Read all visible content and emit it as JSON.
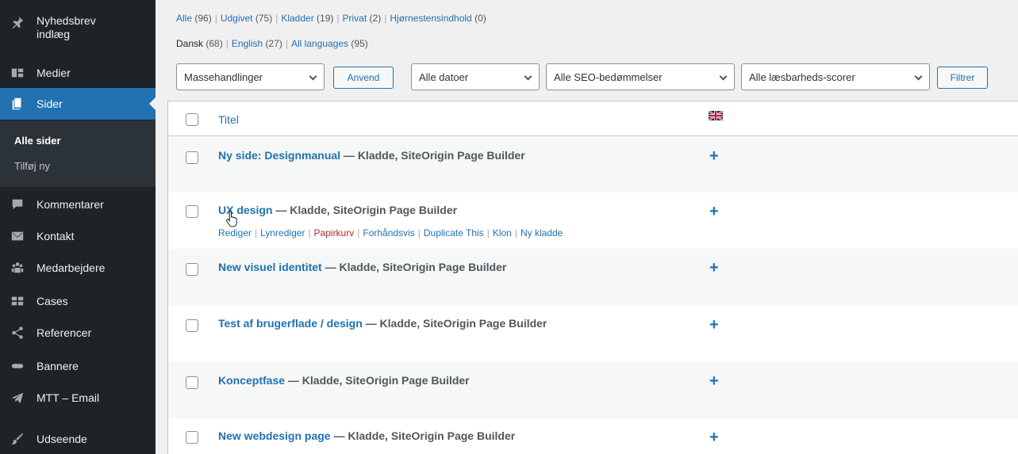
{
  "sidebar": {
    "items": [
      {
        "label": "Nyhedsbrev indlæg",
        "line1": "Nyhedsbrev",
        "line2": "indlæg",
        "icon": "pin-icon"
      },
      {
        "label": "Medier",
        "icon": "media-icon"
      },
      {
        "label": "Sider",
        "icon": "pages-icon",
        "active": true
      },
      {
        "label": "Kommentarer",
        "icon": "comment-icon"
      },
      {
        "label": "Kontakt",
        "icon": "mail-icon"
      },
      {
        "label": "Medarbejdere",
        "icon": "groups-icon"
      },
      {
        "label": "Cases",
        "icon": "grid-icon"
      },
      {
        "label": "Referencer",
        "icon": "share-icon"
      },
      {
        "label": "Bannere",
        "icon": "ellipsis-icon"
      },
      {
        "label": "MTT – Email",
        "icon": "send-icon"
      },
      {
        "label": "Udseende",
        "icon": "brush-icon"
      }
    ],
    "submenu": [
      {
        "label": "Alle sider",
        "current": true
      },
      {
        "label": "Tilføj ny"
      }
    ]
  },
  "filters": {
    "status": [
      {
        "label": "Alle",
        "count": "(96)",
        "current": false
      },
      {
        "label": "Udgivet",
        "count": "(75)"
      },
      {
        "label": "Kladder",
        "count": "(19)"
      },
      {
        "label": "Privat",
        "count": "(2)"
      },
      {
        "label": "Hjørnestensindhold",
        "count": "(0)"
      }
    ],
    "languages": [
      {
        "label": "Dansk",
        "count": "(68)",
        "current": true
      },
      {
        "label": "English",
        "count": "(27)"
      },
      {
        "label": "All languages",
        "count": "(95)"
      }
    ]
  },
  "toolbar": {
    "bulk_select": "Massehandlinger",
    "apply_button": "Anvend",
    "date_select": "Alle datoer",
    "seo_select": "Alle SEO-bedømmelser",
    "readability_select": "Alle læsbarheds-scorer",
    "filter_button": "Filtrer"
  },
  "table": {
    "title_header": "Titel",
    "add_translation": "+",
    "rows": [
      {
        "title": "Ny side: Designmanual",
        "state": " — Kladde, SiteOrigin Page Builder"
      },
      {
        "title": "UX design",
        "state": " — Kladde, SiteOrigin Page Builder",
        "hovered": true
      },
      {
        "title": "New visuel identitet",
        "state": " — Kladde, SiteOrigin Page Builder"
      },
      {
        "title": "Test af brugerflade / design",
        "state": " — Kladde, SiteOrigin Page Builder"
      },
      {
        "title": "Konceptfase",
        "state": " — Kladde, SiteOrigin Page Builder"
      },
      {
        "title": "New webdesign page",
        "state": " — Kladde, SiteOrigin Page Builder"
      }
    ],
    "row_actions": {
      "edit": "Rediger",
      "quick_edit": "Lynrediger",
      "trash": "Papirkurv",
      "preview": "Forhåndsvis",
      "duplicate": "Duplicate This",
      "clone": "Klon",
      "new_draft": "Ny kladde"
    }
  },
  "colors": {
    "sidebar_bg": "#1d2327",
    "accent": "#2271b1",
    "trash": "#b32d2e"
  }
}
